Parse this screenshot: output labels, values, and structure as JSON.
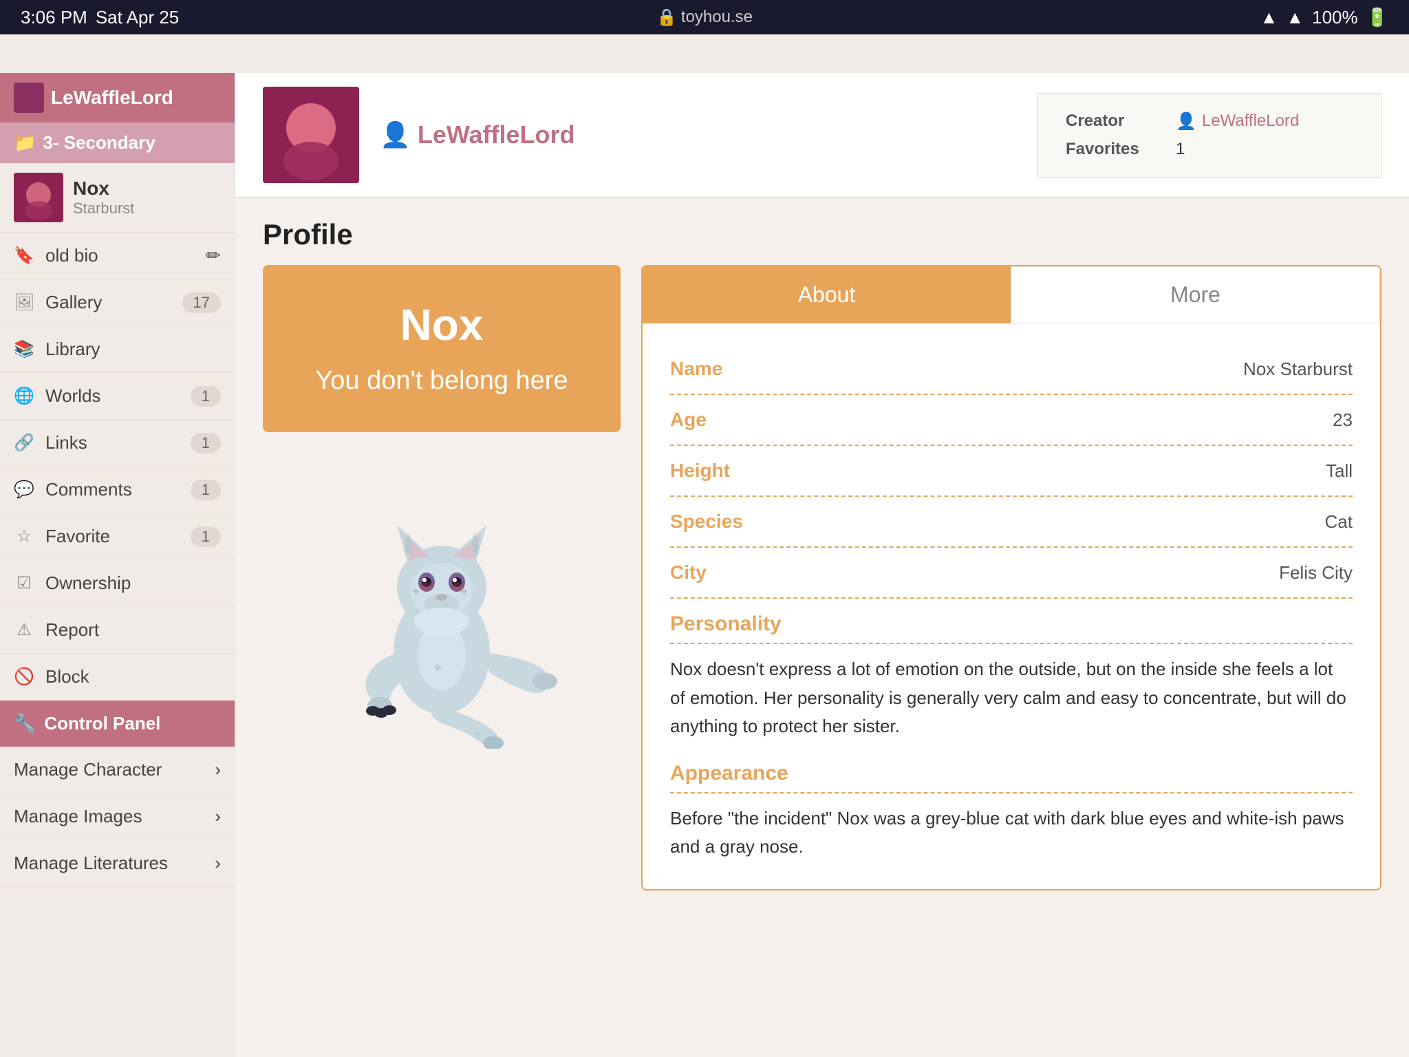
{
  "statusBar": {
    "time": "3:06 PM",
    "date": "Sat Apr 25",
    "url": "toyhou.se",
    "battery": "100%"
  },
  "sidebar": {
    "username": "LeWaffleLord",
    "folder": "3- Secondary",
    "character": {
      "name": "Nox",
      "subtitle": "Starburst"
    },
    "items": [
      {
        "id": "old-bio",
        "label": "old bio",
        "badge": null,
        "hasEdit": true
      },
      {
        "id": "gallery",
        "label": "Gallery",
        "badge": "17",
        "hasEdit": false
      },
      {
        "id": "library",
        "label": "Library",
        "badge": null,
        "hasEdit": false
      },
      {
        "id": "worlds",
        "label": "Worlds",
        "badge": "1",
        "hasEdit": false
      },
      {
        "id": "links",
        "label": "Links",
        "badge": "1",
        "hasEdit": false
      },
      {
        "id": "comments",
        "label": "Comments",
        "badge": "1",
        "hasEdit": false
      },
      {
        "id": "favorite",
        "label": "Favorite",
        "badge": "1",
        "hasEdit": false
      },
      {
        "id": "ownership",
        "label": "Ownership",
        "badge": null,
        "hasEdit": false
      },
      {
        "id": "report",
        "label": "Report",
        "badge": null,
        "hasEdit": false
      },
      {
        "id": "block",
        "label": "Block",
        "badge": null,
        "hasEdit": false
      }
    ],
    "controlPanel": "Control Panel",
    "manageItems": [
      {
        "id": "manage-character",
        "label": "Manage Character",
        "hasArrow": true
      },
      {
        "id": "manage-images",
        "label": "Manage Images",
        "hasArrow": true
      },
      {
        "id": "manage-literatures",
        "label": "Manage Literatures",
        "hasArrow": true
      }
    ]
  },
  "charHeader": {
    "name": "LeWaffleLord",
    "creator_label": "Creator",
    "creator_value": "LeWaffleLord",
    "favorites_label": "Favorites",
    "favorites_value": "1"
  },
  "profile": {
    "title": "Profile",
    "orangeBox": {
      "name": "Nox",
      "subtitle": "You don't belong here"
    },
    "tabs": [
      {
        "id": "about",
        "label": "About",
        "active": true
      },
      {
        "id": "more",
        "label": "More",
        "active": false
      }
    ],
    "fields": [
      {
        "label": "Name",
        "value": "Nox Starburst"
      },
      {
        "label": "Age",
        "value": "23"
      },
      {
        "label": "Height",
        "value": "Tall"
      },
      {
        "label": "Species",
        "value": "Cat"
      },
      {
        "label": "City",
        "value": "Felis City"
      }
    ],
    "sections": [
      {
        "header": "Personality",
        "text": "Nox doesn't express a lot of emotion on the outside, but on the inside she feels a lot of emotion. Her personality is generally very calm and easy to concentrate, but will do anything to protect her sister."
      },
      {
        "header": "Appearance",
        "text": "Before \"the incident\"\nNox was a grey-blue cat with dark blue eyes and white-ish paws and a gray nose."
      }
    ]
  }
}
